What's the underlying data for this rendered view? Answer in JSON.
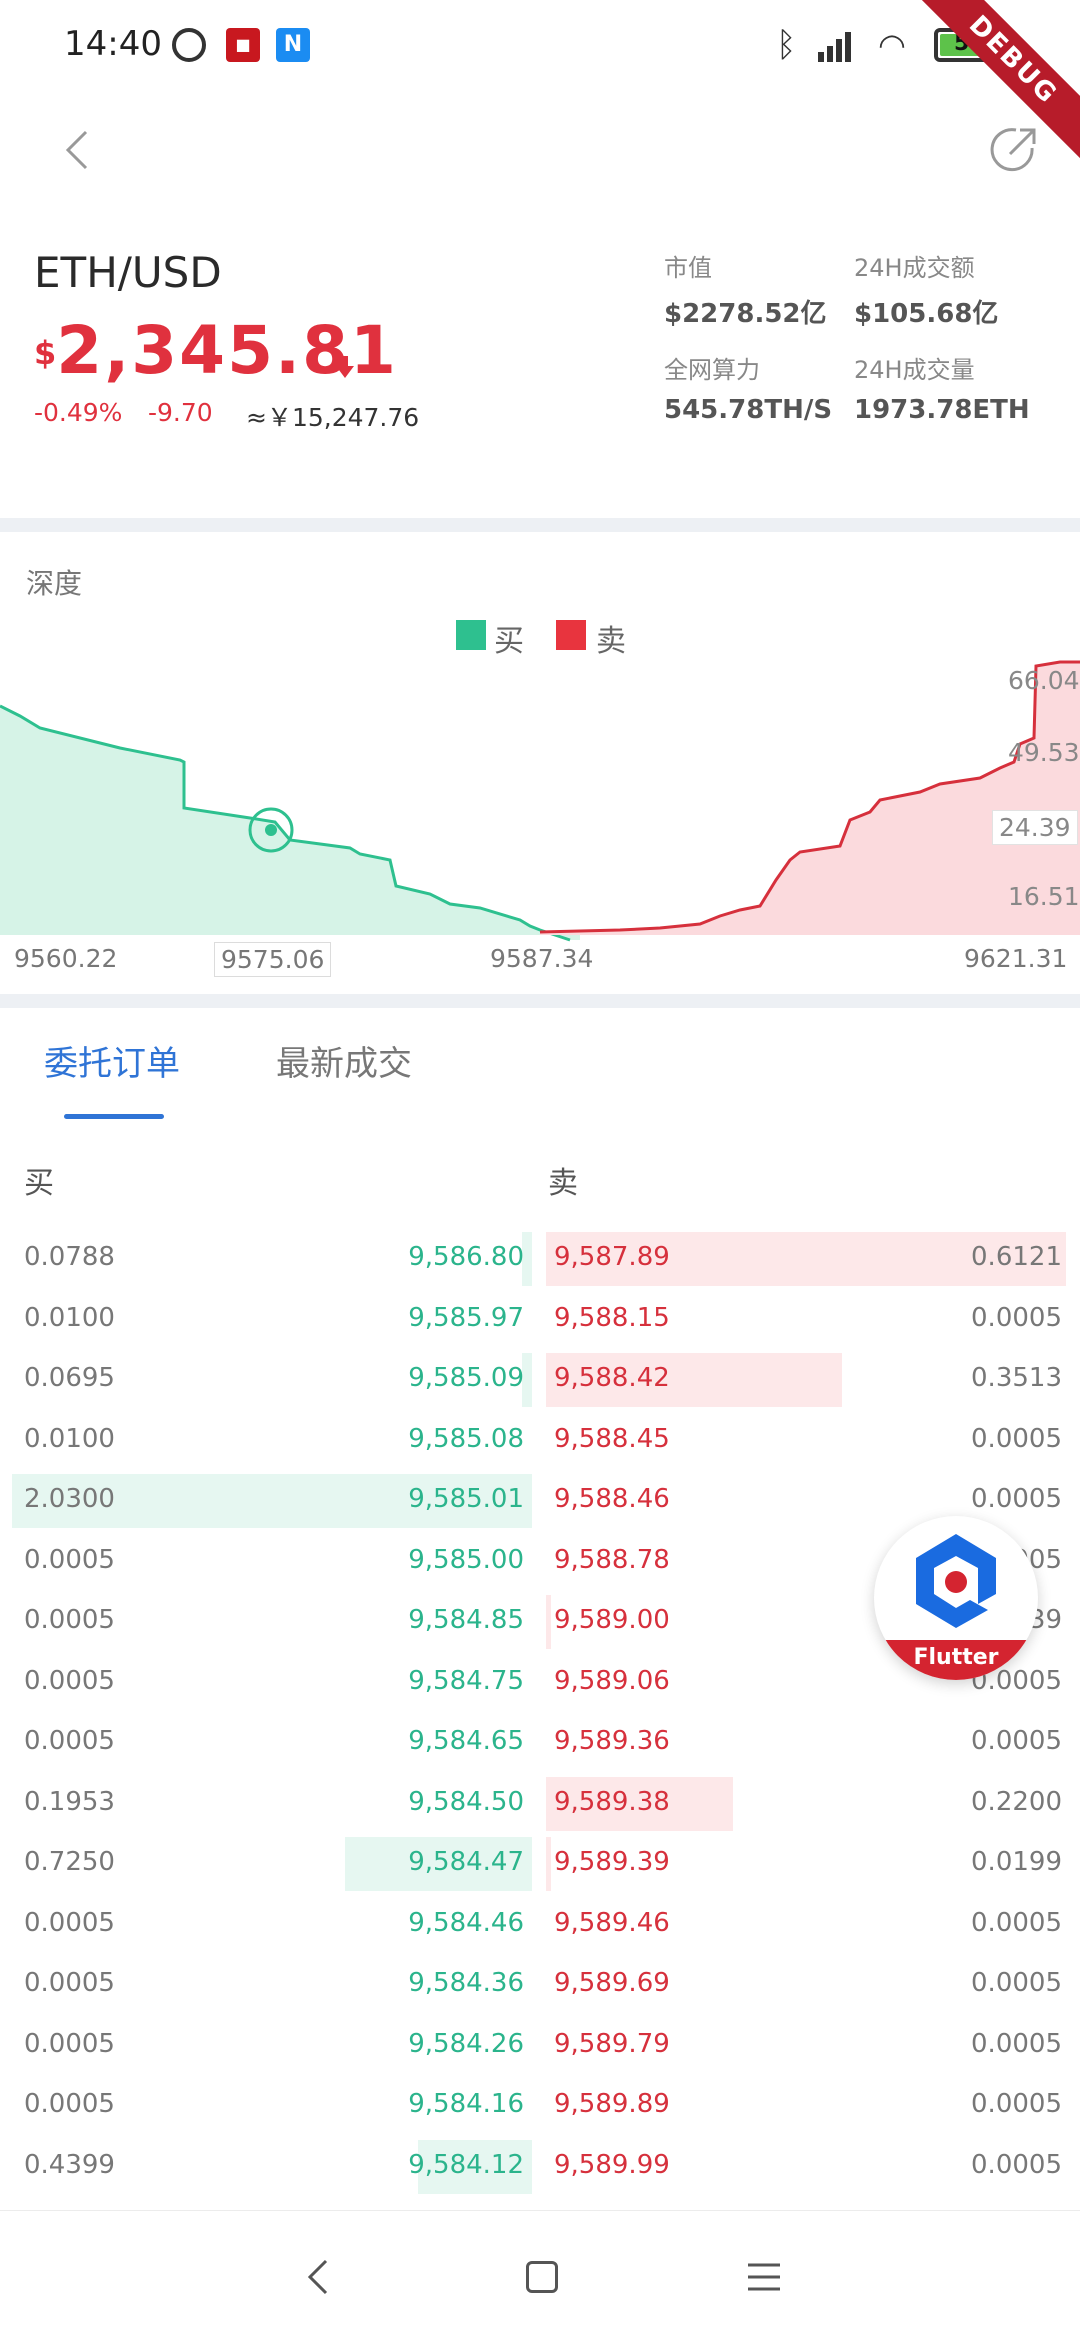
{
  "status_bar": {
    "time": "14:40",
    "battery": "59",
    "debug_label": "DEBUG",
    "icons": [
      "alarm-icon",
      "app-red-icon",
      "app-blue-icon",
      "bluetooth-icon",
      "signal-icon",
      "wifi-icon",
      "battery-icon"
    ]
  },
  "app_bar": {
    "back_icon": "chevron-left-icon",
    "share_icon": "share-icon"
  },
  "header": {
    "pair": "ETH/USD",
    "currency_symbol": "$",
    "price": "2,345.81",
    "change_pct": "-0.49%",
    "change_abs": "-9.70",
    "approx": "≈￥15,247.76",
    "stats": [
      {
        "label": "市值",
        "value": "$2278.52亿"
      },
      {
        "label": "24H成交额",
        "value": "$105.68亿"
      },
      {
        "label": "全网算力",
        "value": "545.78TH/S"
      },
      {
        "label": "24H成交量",
        "value": "1973.78ETH"
      }
    ]
  },
  "depth": {
    "title": "深度",
    "legend_buy": "买",
    "legend_sell": "卖",
    "y_labels": [
      "66.04",
      "49.53",
      "24.39",
      "16.51"
    ],
    "x_labels": [
      "9560.22",
      "9575.06",
      "9587.34",
      "9621.31"
    ],
    "colors": {
      "buy": "#2ec08f",
      "sell": "#e8343e"
    }
  },
  "tabs": [
    "委托订单",
    "最新成交"
  ],
  "book_headers": {
    "buy": "买",
    "sell": "卖"
  },
  "order_book": [
    {
      "bid_qty": "0.0788",
      "bid_price": "9,586.80",
      "ask_price": "9,587.89",
      "ask_qty": "0.6121",
      "bid_depth": 0.02,
      "ask_depth": 1.0
    },
    {
      "bid_qty": "0.0100",
      "bid_price": "9,585.97",
      "ask_price": "9,588.15",
      "ask_qty": "0.0005",
      "bid_depth": 0.0,
      "ask_depth": 0.0
    },
    {
      "bid_qty": "0.0695",
      "bid_price": "9,585.09",
      "ask_price": "9,588.42",
      "ask_qty": "0.3513",
      "bid_depth": 0.02,
      "ask_depth": 0.57
    },
    {
      "bid_qty": "0.0100",
      "bid_price": "9,585.08",
      "ask_price": "9,588.45",
      "ask_qty": "0.0005",
      "bid_depth": 0.0,
      "ask_depth": 0.0
    },
    {
      "bid_qty": "2.0300",
      "bid_price": "9,585.01",
      "ask_price": "9,588.46",
      "ask_qty": "0.0005",
      "bid_depth": 1.0,
      "ask_depth": 0.0
    },
    {
      "bid_qty": "0.0005",
      "bid_price": "9,585.00",
      "ask_price": "9,588.78",
      "ask_qty": "0.0005",
      "bid_depth": 0.0,
      "ask_depth": 0.0
    },
    {
      "bid_qty": "0.0005",
      "bid_price": "9,584.85",
      "ask_price": "9,589.00",
      "ask_qty": "0.0039",
      "bid_depth": 0.0,
      "ask_depth": 0.01
    },
    {
      "bid_qty": "0.0005",
      "bid_price": "9,584.75",
      "ask_price": "9,589.06",
      "ask_qty": "0.0005",
      "bid_depth": 0.0,
      "ask_depth": 0.0
    },
    {
      "bid_qty": "0.0005",
      "bid_price": "9,584.65",
      "ask_price": "9,589.36",
      "ask_qty": "0.0005",
      "bid_depth": 0.0,
      "ask_depth": 0.0
    },
    {
      "bid_qty": "0.1953",
      "bid_price": "9,584.50",
      "ask_price": "9,589.38",
      "ask_qty": "0.2200",
      "bid_depth": 0.0,
      "ask_depth": 0.36
    },
    {
      "bid_qty": "0.7250",
      "bid_price": "9,584.47",
      "ask_price": "9,589.39",
      "ask_qty": "0.0199",
      "bid_depth": 0.36,
      "ask_depth": 0.01
    },
    {
      "bid_qty": "0.0005",
      "bid_price": "9,584.46",
      "ask_price": "9,589.46",
      "ask_qty": "0.0005",
      "bid_depth": 0.0,
      "ask_depth": 0.0
    },
    {
      "bid_qty": "0.0005",
      "bid_price": "9,584.36",
      "ask_price": "9,589.69",
      "ask_qty": "0.0005",
      "bid_depth": 0.0,
      "ask_depth": 0.0
    },
    {
      "bid_qty": "0.0005",
      "bid_price": "9,584.26",
      "ask_price": "9,589.79",
      "ask_qty": "0.0005",
      "bid_depth": 0.0,
      "ask_depth": 0.0
    },
    {
      "bid_qty": "0.0005",
      "bid_price": "9,584.16",
      "ask_price": "9,589.89",
      "ask_qty": "0.0005",
      "bid_depth": 0.0,
      "ask_depth": 0.0
    },
    {
      "bid_qty": "0.4399",
      "bid_price": "9,584.12",
      "ask_price": "9,589.99",
      "ask_qty": "0.0005",
      "bid_depth": 0.22,
      "ask_depth": 0.0
    }
  ],
  "flutter_fab": {
    "label": "Flutter"
  },
  "nav_bar": {
    "icons": [
      "nav-back-icon",
      "nav-home-icon",
      "nav-menu-icon"
    ]
  }
}
